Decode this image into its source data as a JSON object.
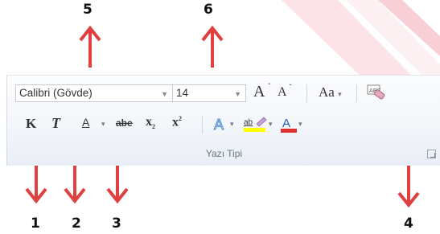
{
  "callouts": {
    "n1": "1",
    "n2": "2",
    "n3": "3",
    "n4": "4",
    "n5": "5",
    "n6": "6"
  },
  "ribbon": {
    "font_name": "Calibri (Gövde)",
    "font_size": "14",
    "group_label": "Yazı Tipi",
    "grow_font": "A",
    "shrink_font": "A",
    "change_case": "Aa",
    "bold": "K",
    "italic": "T",
    "underline": "A",
    "strikethrough": "abe",
    "subscript": "x",
    "subscript_mark": "2",
    "superscript": "x",
    "superscript_mark": "2",
    "highlight": "ab",
    "font_color": "A"
  },
  "colors": {
    "arrow": "#e04040",
    "highlight_bar": "#ffff00",
    "font_color_bar": "#e03030"
  }
}
